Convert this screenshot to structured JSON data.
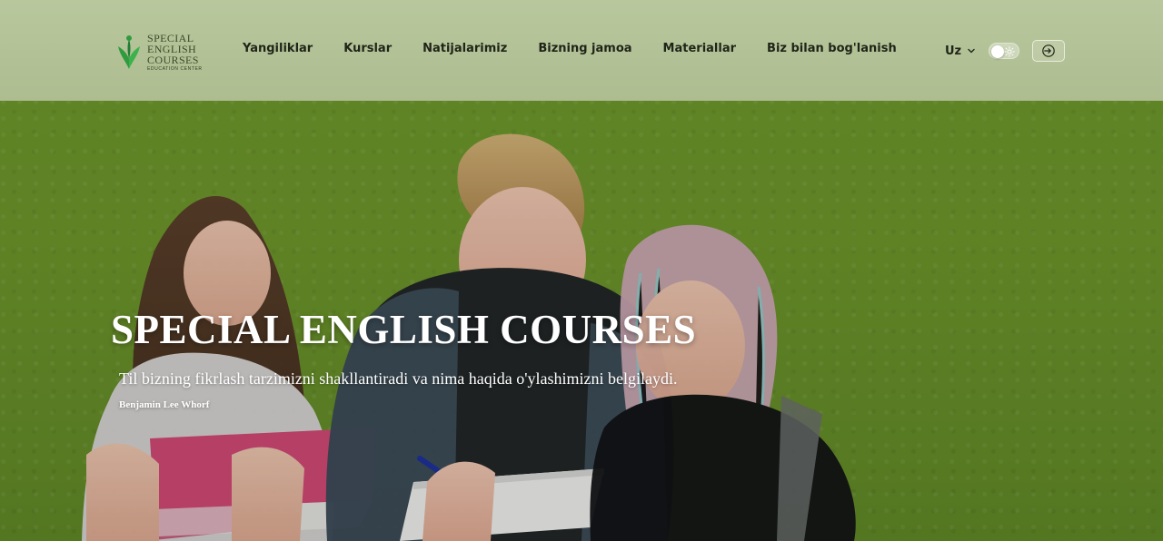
{
  "brand": {
    "logo_lines": [
      "SPECIAL",
      "ENGLISH",
      "COURSES"
    ],
    "logo_subtitle": "EDUCATION CENTER",
    "logo_icon": "leaf-person-icon",
    "brand_green": "#2ea043"
  },
  "nav": {
    "items": [
      {
        "label": "Yangiliklar"
      },
      {
        "label": "Kurslar"
      },
      {
        "label": "Natijalarimiz"
      },
      {
        "label": "Bizning jamoa"
      },
      {
        "label": "Materiallar"
      },
      {
        "label": "Biz bilan bog'lanish"
      }
    ]
  },
  "header_actions": {
    "language_label": "Uz",
    "language_icon": "chevron-down-icon",
    "theme_toggle_icon": "sun-icon",
    "login_icon": "login-icon"
  },
  "hero": {
    "title": "SPECIAL ENGLISH COURSES",
    "quote": "Til bizning fikrlash tarzimizni shakllantiradi va nima haqida o'ylashimizni belgilaydi.",
    "author": "Benjamin Lee Whorf"
  },
  "colors": {
    "header_bg": "#b8c79d",
    "hero_bg": "#6a922a",
    "text_dark": "#1f2418",
    "text_light": "#ffffff"
  }
}
